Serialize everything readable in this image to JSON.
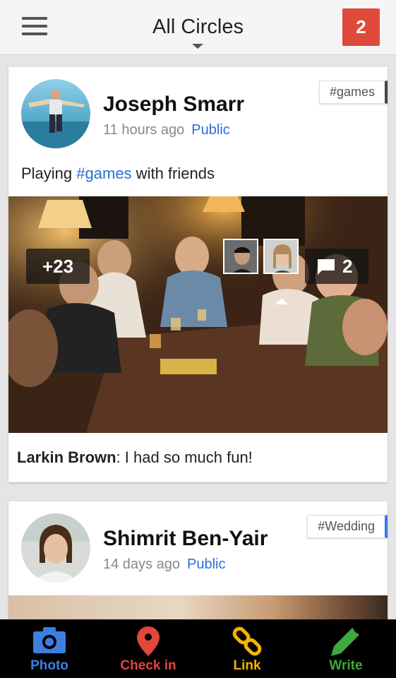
{
  "header": {
    "title": "All Circles",
    "notification_count": "2"
  },
  "posts": [
    {
      "author": "Joseph Smarr",
      "time": "11 hours ago",
      "visibility": "Public",
      "tag": "#games",
      "text_before": "Playing ",
      "text_hashtag": "#games",
      "text_after": " with friends",
      "plus_count": "+23",
      "comment_count": "2",
      "comment_author": "Larkin Brown",
      "comment_text": ": I had so much fun!"
    },
    {
      "author": "Shimrit Ben-Yair",
      "time": "14 days ago",
      "visibility": "Public",
      "tag": "#Wedding"
    }
  ],
  "actions": [
    {
      "label": "Photo",
      "icon": "camera-icon",
      "color": "#3d7fe0"
    },
    {
      "label": "Check in",
      "icon": "map-pin-icon",
      "color": "#e0463a"
    },
    {
      "label": "Link",
      "icon": "link-icon",
      "color": "#f4b400"
    },
    {
      "label": "Write",
      "icon": "pencil-icon",
      "color": "#3fa83f"
    }
  ]
}
